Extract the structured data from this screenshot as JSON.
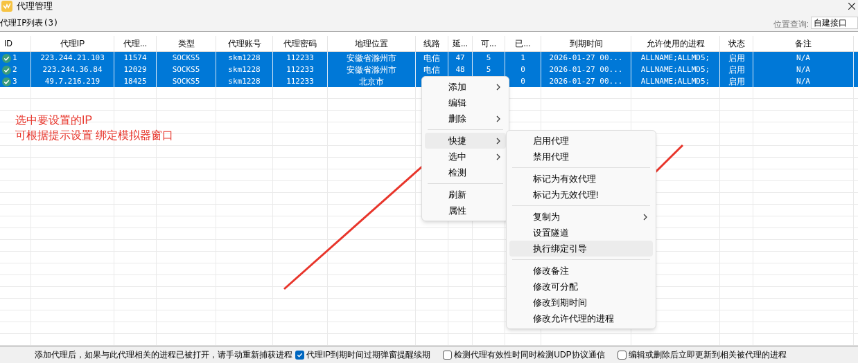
{
  "window": {
    "title": "代理管理"
  },
  "list_label": "代理IP列表(3)",
  "location_query": {
    "label": "位置查询:",
    "value": "自建接口"
  },
  "table": {
    "columns": [
      "ID",
      "代理IP",
      "代理...",
      "类型",
      "代理账号",
      "代理密码",
      "地理位置",
      "线路",
      "延...",
      "可...",
      "已...",
      "到期时间",
      "允许使用的进程",
      "状态",
      "备注"
    ],
    "rows": [
      {
        "selected": true,
        "status_ok": true,
        "cells": [
          "1",
          "223.244.21.103",
          "11574",
          "SOCKS5",
          "skm1228",
          "112233",
          "安徽省滁州市",
          "电信",
          "47",
          "5",
          "1",
          "2026-01-27 00...",
          "ALLNAME;ALLMD5;",
          "启用",
          "N/A"
        ]
      },
      {
        "selected": true,
        "status_ok": true,
        "cells": [
          "2",
          "223.244.36.84",
          "12029",
          "SOCKS5",
          "skm1228",
          "112233",
          "安徽省滁州市",
          "电信",
          "48",
          "5",
          "0",
          "2026-01-27 00...",
          "ALLNAME;ALLMD5;",
          "启用",
          "N/A"
        ]
      },
      {
        "selected": true,
        "status_ok": true,
        "cells": [
          "3",
          "49.7.216.219",
          "18425",
          "SOCKS5",
          "skm1228",
          "112233",
          "北京市",
          null,
          null,
          null,
          "0",
          "2026-01-27 00...",
          "ALLNAME;ALLMD5;",
          "启用",
          "N/A"
        ]
      }
    ]
  },
  "annotation": [
    "选中要设置的IP",
    "可根据提示设置 绑定模拟器窗口"
  ],
  "context_menu": {
    "groups": [
      [
        {
          "label": "添加",
          "submenu": true,
          "highlighted": false
        },
        {
          "label": "编辑",
          "submenu": false,
          "highlighted": false
        },
        {
          "label": "删除",
          "submenu": true,
          "highlighted": false
        }
      ],
      [
        {
          "label": "快捷",
          "submenu": true,
          "highlighted": true
        },
        {
          "label": "选中",
          "submenu": true,
          "highlighted": false
        },
        {
          "label": "检测",
          "submenu": false,
          "highlighted": false
        }
      ],
      [
        {
          "label": "刷新",
          "submenu": false,
          "highlighted": false
        },
        {
          "label": "属性",
          "submenu": false,
          "highlighted": false
        }
      ]
    ]
  },
  "submenu": {
    "groups": [
      [
        {
          "label": "启用代理",
          "submenu": false,
          "highlighted": false
        },
        {
          "label": "禁用代理",
          "submenu": false,
          "highlighted": false
        }
      ],
      [
        {
          "label": "标记为有效代理",
          "submenu": false,
          "highlighted": false
        },
        {
          "label": "标记为无效代理!",
          "submenu": false,
          "highlighted": false
        }
      ],
      [
        {
          "label": "复制为",
          "submenu": true,
          "highlighted": false
        },
        {
          "label": "设置隧道",
          "submenu": false,
          "highlighted": false
        },
        {
          "label": "执行绑定引导",
          "submenu": false,
          "highlighted": true
        }
      ],
      [
        {
          "label": "修改备注",
          "submenu": false,
          "highlighted": false
        },
        {
          "label": "修改可分配",
          "submenu": false,
          "highlighted": false
        },
        {
          "label": "修改到期时间",
          "submenu": false,
          "highlighted": false
        },
        {
          "label": "修改允许代理的进程",
          "submenu": false,
          "highlighted": false
        }
      ]
    ]
  },
  "status_bar": {
    "note": "添加代理后，如果与此代理相关的进程已被打开，请手动重新捕获进程",
    "options": [
      {
        "label": "代理IP到期时间过期弹窗提醒续期",
        "checked": true
      },
      {
        "label": "检测代理有效性时同时检测UDP协议通信",
        "checked": false
      },
      {
        "label": "编辑或删除后立即更新到相关被代理的进程",
        "checked": false
      }
    ]
  }
}
